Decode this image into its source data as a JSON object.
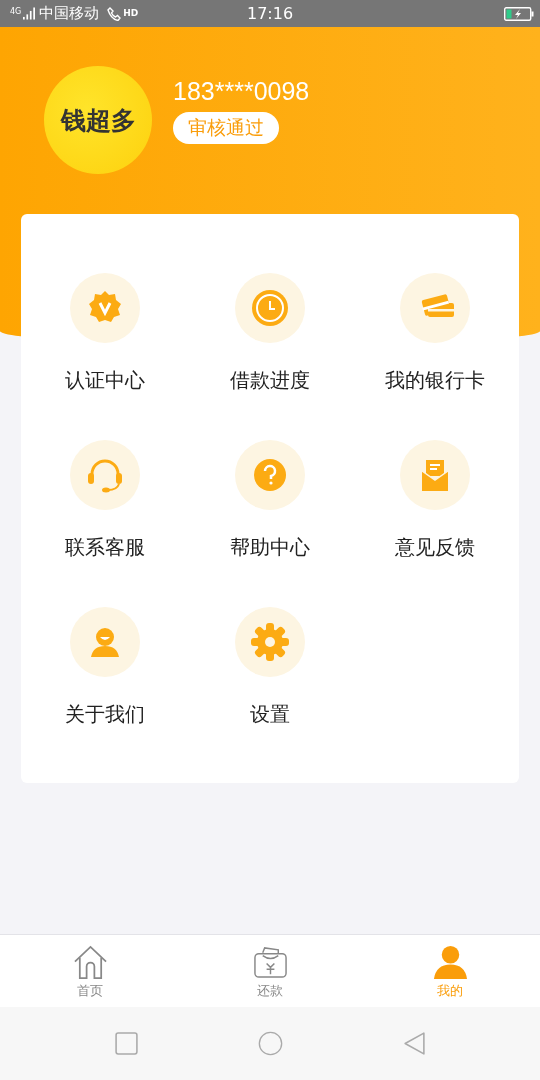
{
  "status_bar": {
    "network": "4G",
    "carrier": "中国移动",
    "call_badge": "HD",
    "time": "17:16"
  },
  "profile": {
    "logo_text": "钱超多",
    "phone": "183****0098",
    "status_badge": "审核通过"
  },
  "menu": [
    {
      "label": "认证中心",
      "kind": "badge"
    },
    {
      "label": "借款进度",
      "kind": "clock"
    },
    {
      "label": "我的银行卡",
      "kind": "cards"
    },
    {
      "label": "联系客服",
      "kind": "headset"
    },
    {
      "label": "帮助中心",
      "kind": "help"
    },
    {
      "label": "意见反馈",
      "kind": "mail"
    },
    {
      "label": "关于我们",
      "kind": "person"
    },
    {
      "label": "设置",
      "kind": "settings"
    }
  ],
  "tabs": [
    {
      "label": "首页",
      "kind": "home",
      "selected": false
    },
    {
      "label": "还款",
      "kind": "wallet",
      "selected": false
    },
    {
      "label": "我的",
      "kind": "user",
      "selected": true
    }
  ]
}
